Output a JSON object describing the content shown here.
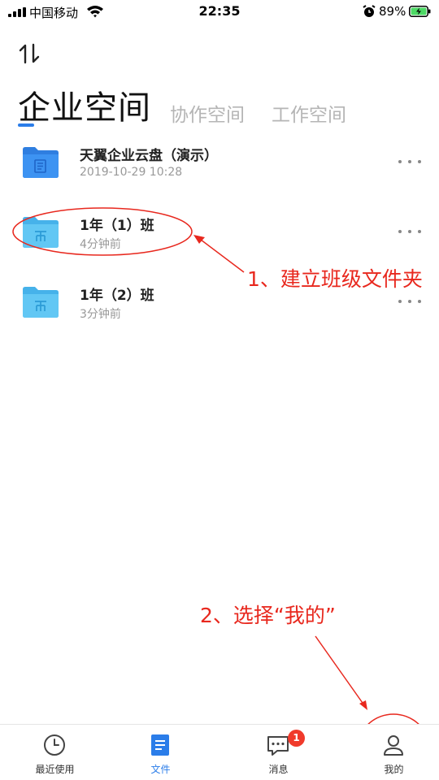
{
  "status_bar": {
    "carrier": "中国移动",
    "time": "22:35",
    "battery_percent": "89%"
  },
  "tabs": [
    {
      "label": "企业空间",
      "active": true
    },
    {
      "label": "协作空间",
      "active": false
    },
    {
      "label": "工作空间",
      "active": false
    }
  ],
  "files": [
    {
      "name": "天翼企业云盘（演示）",
      "meta": "2019-10-29 10:28",
      "icon": "folder-document-icon"
    },
    {
      "name": "1年（1）班",
      "meta": "4分钟前",
      "icon": "folder-shared-icon"
    },
    {
      "name": "1年（2）班",
      "meta": "3分钟前",
      "icon": "folder-shared-icon"
    }
  ],
  "annotations": {
    "step1": "1、建立班级文件夹",
    "step2": "2、选择“我的”"
  },
  "tab_bar": {
    "items": [
      {
        "label": "最近使用",
        "icon": "clock-icon",
        "active": false
      },
      {
        "label": "文件",
        "icon": "document-icon",
        "active": true
      },
      {
        "label": "消息",
        "icon": "chat-icon",
        "active": false,
        "badge": "1"
      },
      {
        "label": "我的",
        "icon": "person-icon",
        "active": false
      }
    ]
  },
  "colors": {
    "accent": "#2b7de9",
    "folder_blue": "#3a8ff0",
    "folder_light": "#5cc3f2",
    "annotation_red": "#e8281e",
    "badge_red": "#f03a2b"
  }
}
